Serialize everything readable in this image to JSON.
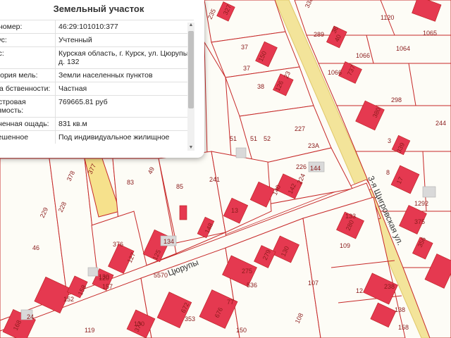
{
  "popup": {
    "title": "Земельный участок",
    "rows": [
      {
        "key": "д. номер:",
        "value": "46:29:101010:377"
      },
      {
        "key": "атус:",
        "value": "Учтенный"
      },
      {
        "key": "рес:",
        "value": "Курская область, г. Курск, ул. Цюрупы, д. 132"
      },
      {
        "key": "тегория мель:",
        "value": "Земли населенных пунктов"
      },
      {
        "key": "рма бственности:",
        "value": "Частная"
      },
      {
        "key": "дастровая оимость:",
        "value": "769665.81 руб"
      },
      {
        "key": "очненная ощадь:",
        "value": "831 кв.м"
      },
      {
        "key": "зрешенное",
        "value": "Под индивидуальное жилищное"
      }
    ],
    "scroll_up_icon": "triangle-up-icon",
    "scroll_down_icon": "triangle-down-icon"
  },
  "map": {
    "streets": {
      "main": "3-я Щигровская ул.",
      "cross": "Цюрупы"
    },
    "plot_labels": [
      "235",
      "327",
      "338",
      "1120",
      "289",
      "36",
      "40",
      "1065",
      "37",
      "150",
      "51",
      "1066",
      "1064",
      "1066",
      "737",
      "37",
      "23",
      "38",
      "126",
      "298",
      "380",
      "227",
      "244",
      "3",
      "51",
      "52",
      "23А",
      "339",
      "17",
      "226",
      "144",
      "224",
      "378",
      "377",
      "49",
      "83",
      "241",
      "85",
      "140",
      "142",
      "8",
      "1292",
      "375",
      "229",
      "228",
      "13",
      "134",
      "125",
      "130",
      "148",
      "133",
      "280",
      "109",
      "356",
      "46",
      "376",
      "127",
      "5570",
      "275",
      "279",
      "130",
      "536",
      "107",
      "12",
      "238",
      "138",
      "120",
      "158",
      "157",
      "152",
      "168",
      "24",
      "672",
      "353",
      "676",
      "77",
      "130",
      "150",
      "158",
      "119",
      "377",
      "108"
    ]
  },
  "colors": {
    "plot_border": "#c62828",
    "building": "#e53950",
    "selected_plot": "#f6e18c",
    "road": "#f3e49a"
  }
}
